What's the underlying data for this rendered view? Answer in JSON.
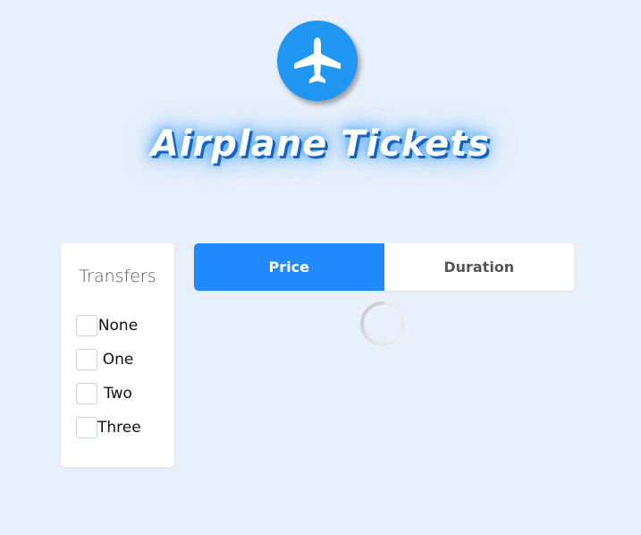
{
  "header": {
    "logo_icon": "airplane-icon",
    "title": "Airplane Tickets",
    "accent_color": "#2196f3"
  },
  "filters": {
    "title": "Transfers",
    "options": [
      {
        "label": "None",
        "checked": false
      },
      {
        "label": "One",
        "checked": false
      },
      {
        "label": "Two",
        "checked": false
      },
      {
        "label": "Three",
        "checked": false
      }
    ]
  },
  "sort": {
    "tabs": [
      {
        "label": "Price",
        "active": true
      },
      {
        "label": "Duration",
        "active": false
      }
    ],
    "active_color": "#2389ff"
  },
  "loading": {
    "icon": "loading-spinner-icon"
  }
}
